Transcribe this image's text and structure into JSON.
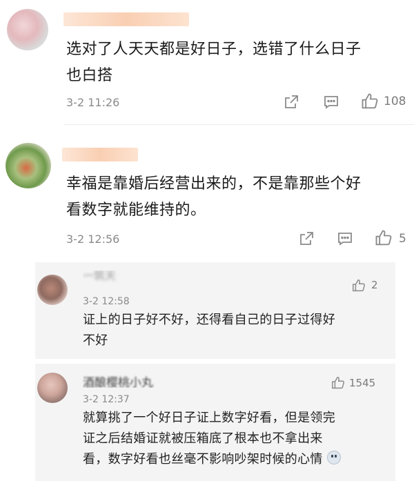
{
  "comments": [
    {
      "text_line1": "选对了人天天都是好日子，选错了什么日子",
      "text_line2": "也白搭",
      "time": "3-2 11:26",
      "like_count": "108",
      "colors": {
        "name_blur": "#fbdcc7",
        "avatar": "#d8d8d8"
      }
    },
    {
      "text_line1": "幸福是靠婚后经营出来的，不是靠那些个好",
      "text_line2": "看数字就能维持的。",
      "time": "3-2 12:56",
      "like_count": "5",
      "colors": {
        "name_blur": "#fbdcc7",
        "avatar": "#9fb87a"
      }
    }
  ],
  "replies": [
    {
      "name_partial": "一筑天",
      "time": "3-2 12:58",
      "like_count": "2",
      "text_line1": "证上的日子好不好，还得看自己的日子过得好",
      "text_line2": "不好"
    },
    {
      "name_partial": "酒酿樱桃小丸",
      "time": "3-2 12:37",
      "like_count": "1545",
      "text_line1": "就算挑了一个好日子证上数字好看，但是领完",
      "text_line2": "证之后结婚证就被压箱底了根本也不拿出来",
      "text_line3": "看，数字好看也丝毫不影响吵架时候的心情"
    }
  ],
  "icons": {
    "share": "share-icon",
    "comment": "comment-icon",
    "like": "thumbs-up-icon",
    "emoji": "sweat-emoji-icon"
  },
  "theme": {
    "text": "#1a1a1a",
    "meta": "#8a8a8a",
    "reply_bg": "#f4f4f4"
  }
}
